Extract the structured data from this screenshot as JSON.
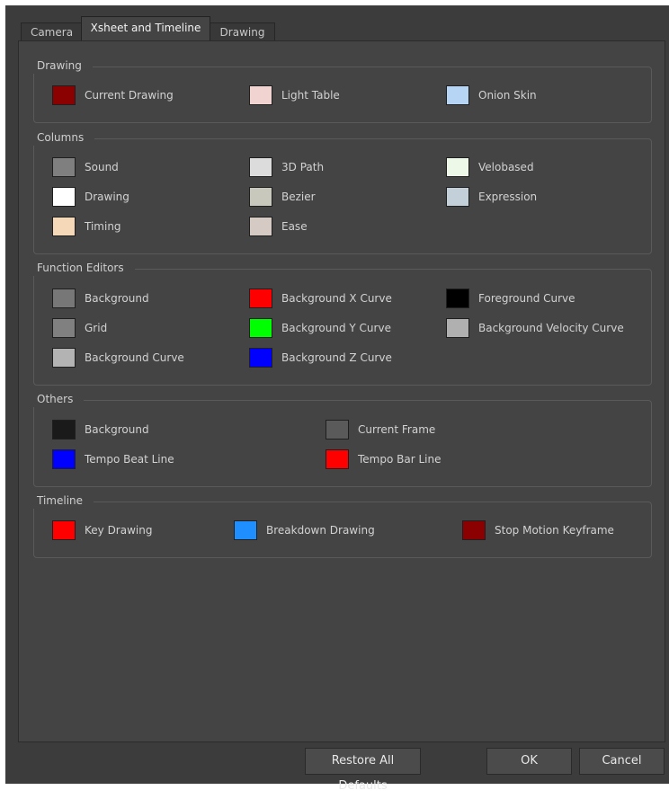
{
  "tabs": [
    {
      "label": "Camera"
    },
    {
      "label": "Xsheet and Timeline"
    },
    {
      "label": "Drawing"
    }
  ],
  "groups": {
    "drawing": {
      "title": "Drawing",
      "items": [
        {
          "label": "Current Drawing",
          "color": "#8b0000"
        },
        {
          "label": "Light Table",
          "color": "#f1d4d2"
        },
        {
          "label": "Onion Skin",
          "color": "#b6d4f4"
        }
      ]
    },
    "columns": {
      "title": "Columns",
      "items": [
        {
          "label": "Sound",
          "color": "#7f7f7f"
        },
        {
          "label": "3D Path",
          "color": "#dcdcdc"
        },
        {
          "label": "Velobased",
          "color": "#eef8e8"
        },
        {
          "label": "Drawing",
          "color": "#ffffff"
        },
        {
          "label": "Bezier",
          "color": "#c9c8bc"
        },
        {
          "label": "Expression",
          "color": "#c3cfd9"
        },
        {
          "label": "Timing",
          "color": "#f4d8b8"
        },
        {
          "label": "Ease",
          "color": "#d6cbc4"
        }
      ]
    },
    "function_editors": {
      "title": "Function Editors",
      "items": [
        {
          "label": "Background",
          "color": "#777777"
        },
        {
          "label": "Background X Curve",
          "color": "#ff0000"
        },
        {
          "label": "Foreground Curve",
          "color": "#000000"
        },
        {
          "label": "Grid",
          "color": "#808080"
        },
        {
          "label": "Background Y Curve",
          "color": "#00ff00"
        },
        {
          "label": "Background Velocity Curve",
          "color": "#b0b0b0"
        },
        {
          "label": "Background Curve",
          "color": "#b3b3b3"
        },
        {
          "label": "Background Z Curve",
          "color": "#0000ff"
        }
      ]
    },
    "others": {
      "title": "Others",
      "items": [
        {
          "label": "Background",
          "color": "#1a1a1a"
        },
        {
          "label": "Current Frame",
          "color": "#5a5a5a"
        },
        {
          "label": "Tempo Beat Line",
          "color": "#0000ff"
        },
        {
          "label": "Tempo Bar Line",
          "color": "#ff0000"
        }
      ]
    },
    "timeline": {
      "title": "Timeline",
      "items": [
        {
          "label": "Key Drawing",
          "color": "#ff0000"
        },
        {
          "label": "Breakdown Drawing",
          "color": "#1f8fff"
        },
        {
          "label": "Stop Motion Keyframe",
          "color": "#8b0000"
        }
      ]
    }
  },
  "buttons": {
    "restore": "Restore All Defaults",
    "ok": "OK",
    "cancel": "Cancel"
  }
}
